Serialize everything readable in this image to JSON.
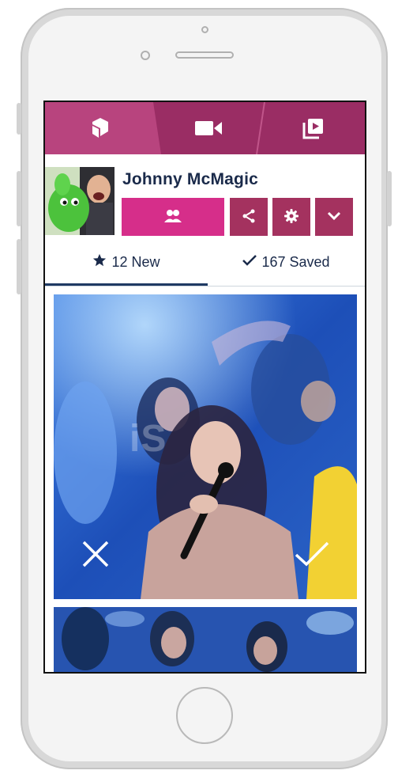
{
  "profile": {
    "name": "Johnny McMagic"
  },
  "tabs": {
    "new": {
      "count_label": "12 New"
    },
    "saved": {
      "count_label": "167 Saved"
    }
  },
  "photo": {
    "watermark": "iS"
  },
  "icons": {
    "nav": [
      "logo-icon",
      "video-camera-icon",
      "playlist-icon"
    ],
    "profile_buttons": [
      "followers-icon",
      "share-icon",
      "gear-icon",
      "chevron-down-icon"
    ],
    "tabs": [
      "star-icon",
      "checkmark-icon"
    ],
    "photo_actions": [
      "close-icon",
      "checkmark-icon"
    ]
  },
  "colors": {
    "nav_bg": "#9a2d64",
    "nav_active": "#b8447e",
    "primary_button": "#d62e8a",
    "secondary_button": "#a4325f",
    "text_dark": "#1a2a4a",
    "tab_underline": "#1f3a63"
  }
}
